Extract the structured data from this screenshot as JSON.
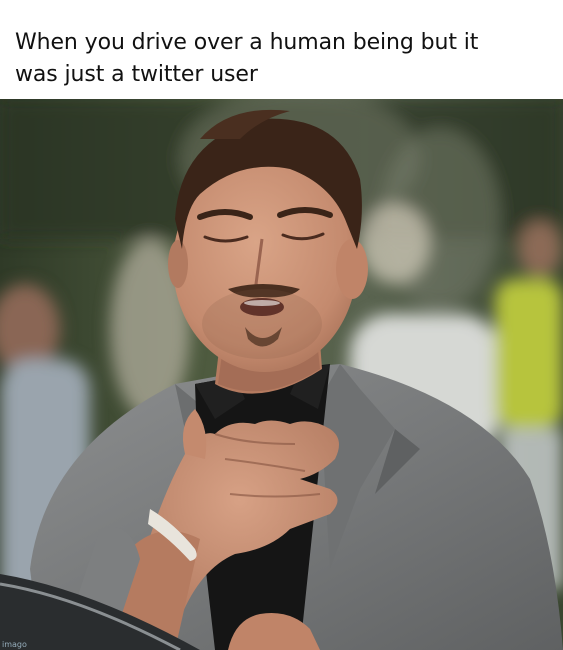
{
  "meme": {
    "caption_line1": "When you drive over a human being but it",
    "caption_line2": "was just a twitter user",
    "image_description": "Man in grey blazer with eyes closed, hand on chest, exhaling in relief",
    "watermark_text": "imago",
    "colors": {
      "caption_bg": "#ffffff",
      "caption_text": "#111111",
      "suit": "#7d7f80",
      "shirt": "#151515",
      "skin": "#c99177",
      "hair": "#3a2418",
      "background_foliage": "#3f4a33"
    }
  }
}
